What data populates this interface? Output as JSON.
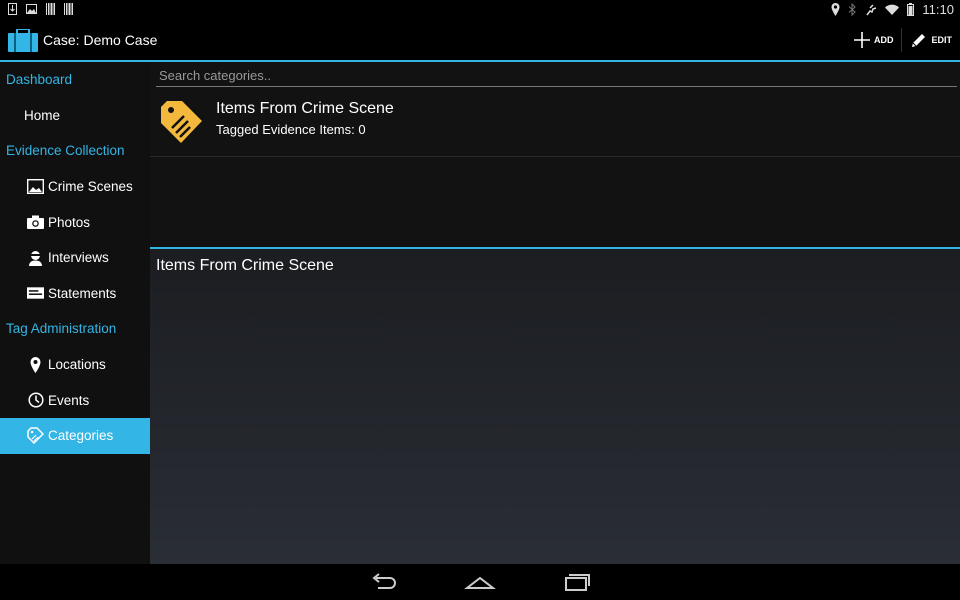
{
  "status_bar": {
    "time": "11:10",
    "left_icons": [
      "download-icon",
      "image-icon",
      "barcode-icon",
      "barcode-icon"
    ],
    "right_icons": [
      "location-icon",
      "bluetooth-icon",
      "nfc-icon",
      "wifi-icon",
      "battery-icon"
    ]
  },
  "action_bar": {
    "title": "Case: Demo Case",
    "add_label": "ADD",
    "edit_label": "EDIT"
  },
  "sidebar": {
    "sections": [
      {
        "label": "Dashboard",
        "items": [
          {
            "label": "Home",
            "icon": ""
          }
        ]
      },
      {
        "label": "Evidence Collection",
        "items": [
          {
            "label": "Crime Scenes",
            "icon": "image-icon"
          },
          {
            "label": "Photos",
            "icon": "camera-icon"
          },
          {
            "label": "Interviews",
            "icon": "person-icon"
          },
          {
            "label": "Statements",
            "icon": "statement-icon"
          }
        ]
      },
      {
        "label": "Tag Administration",
        "items": [
          {
            "label": "Locations",
            "icon": "location-pin-icon"
          },
          {
            "label": "Events",
            "icon": "clock-icon"
          },
          {
            "label": "Categories",
            "icon": "tag-icon"
          }
        ]
      }
    ],
    "active_item": "Categories"
  },
  "main": {
    "search_placeholder": "Search categories..",
    "categories": [
      {
        "title": "Items From Crime Scene",
        "subtitle": "Tagged Evidence Items:  0",
        "icon": "tag-icon"
      }
    ],
    "detail_title": "Items From Crime Scene"
  },
  "colors": {
    "accent": "#33b5e5",
    "tag_icon": "#f4b83c"
  }
}
